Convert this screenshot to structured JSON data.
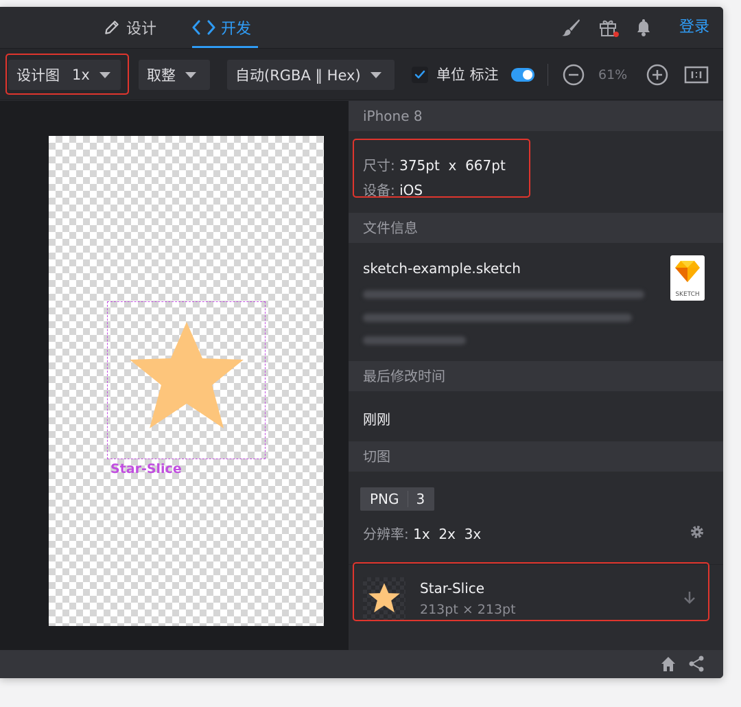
{
  "tabs": {
    "design": "设计",
    "develop": "开发"
  },
  "header": {
    "login": "登录"
  },
  "toolbar": {
    "design_label": "设计图",
    "scale_value": "1x",
    "rounding": "取整",
    "color_format": "自动(RGBA ‖ Hex)",
    "unit_label": "单位 标注",
    "zoom": "61%"
  },
  "canvas": {
    "slice_label": "Star-Slice",
    "star_color": "#fdc57b",
    "slice_color": "#c14ee0"
  },
  "panel": {
    "device_name": "iPhone 8",
    "size_key": "尺寸:",
    "size_value": "375pt  x  667pt",
    "device_key": "设备:",
    "device_value": "iOS",
    "file_info_title": "文件信息",
    "file_name": "sketch-example.sketch",
    "file_icon_label": "SKETCH",
    "last_modified_title": "最后修改时间",
    "last_modified_value": "刚刚",
    "slices_title": "切图",
    "format": "PNG",
    "format_count": "3",
    "resolution_key": "分辨率:",
    "resolution_value": "1x  2x  3x",
    "asset_name": "Star-Slice",
    "asset_size": "213pt × 213pt"
  },
  "colors": {
    "accent": "#2f9bf4",
    "highlight": "#e0352d"
  }
}
